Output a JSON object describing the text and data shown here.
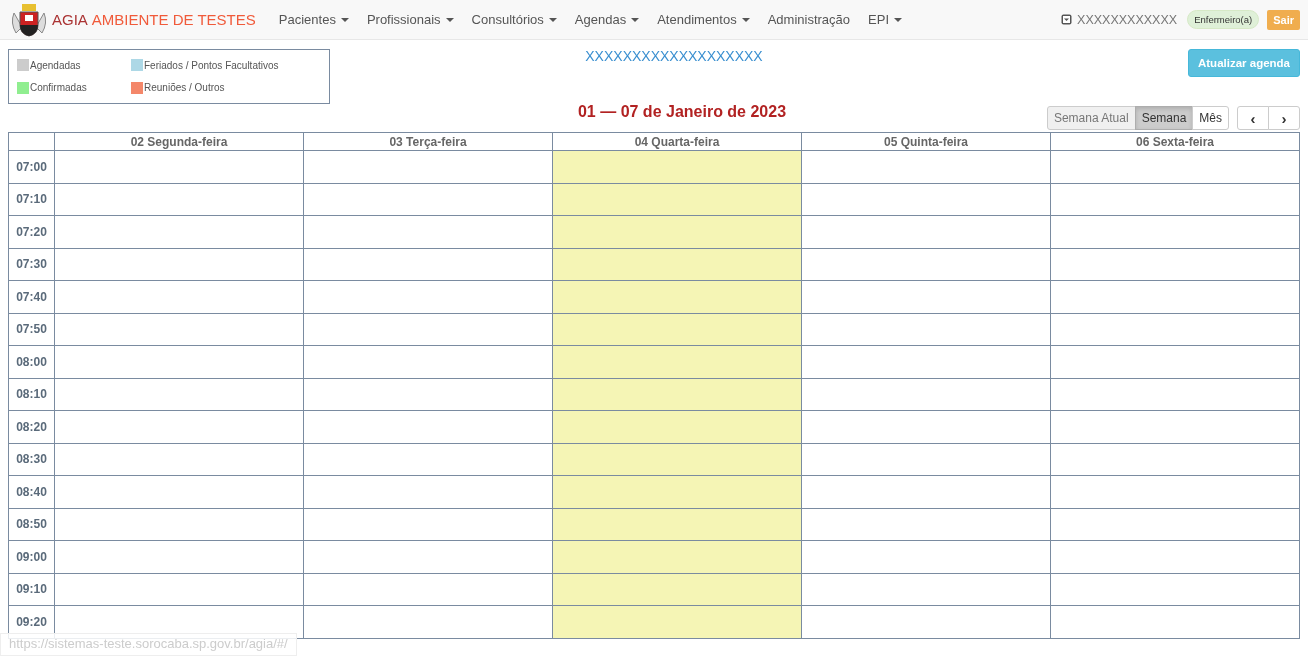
{
  "navbar": {
    "brand_prefix": "AGIA",
    "brand_suffix": "AMBIENTE DE TESTES",
    "menu": [
      {
        "label": "Pacientes",
        "dropdown": true
      },
      {
        "label": "Profissionais",
        "dropdown": true
      },
      {
        "label": "Consultórios",
        "dropdown": true
      },
      {
        "label": "Agendas",
        "dropdown": true
      },
      {
        "label": "Atendimentos",
        "dropdown": true
      },
      {
        "label": "Administração",
        "dropdown": false
      },
      {
        "label": "EPI",
        "dropdown": true
      }
    ],
    "user": "XXXXXXXXXXXX",
    "role": "Enfermeiro(a)",
    "logout": "Sair"
  },
  "legend": [
    {
      "label": "Agendadas",
      "color": "#cccccc"
    },
    {
      "label": "Feriados / Pontos Facultativos",
      "color": "#add8e6"
    },
    {
      "label": "Confirmadas",
      "color": "#90ee90"
    },
    {
      "label": "Reuniões / Outros",
      "color": "#f4876a"
    }
  ],
  "agenda_title": "XXXXXXXXXXXXXXXXXXX",
  "refresh_button": "Atualizar agenda",
  "date_range": "01 — 07 de Janeiro de 2023",
  "views": [
    {
      "label": "Semana Atual",
      "selected": false,
      "disabled": true
    },
    {
      "label": "Semana",
      "selected": true,
      "disabled": false
    },
    {
      "label": "Mês",
      "selected": false,
      "disabled": false
    }
  ],
  "nav_buttons": [
    "‹",
    "›"
  ],
  "calendar": {
    "days": [
      {
        "label": "02 Segunda-feira",
        "today": false
      },
      {
        "label": "03 Terça-feira",
        "today": false
      },
      {
        "label": "04 Quarta-feira",
        "today": true
      },
      {
        "label": "05 Quinta-feira",
        "today": false
      },
      {
        "label": "06 Sexta-feira",
        "today": false
      }
    ],
    "times": [
      "07:00",
      "07:10",
      "07:20",
      "07:30",
      "07:40",
      "07:50",
      "08:00",
      "08:10",
      "08:20",
      "08:30",
      "08:40",
      "08:50",
      "09:00",
      "09:10",
      "09:20"
    ]
  },
  "status_bar": "https://sistemas-teste.sorocaba.sp.gov.br/agia/#/"
}
